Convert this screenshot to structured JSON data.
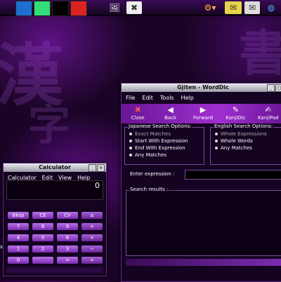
{
  "panel": {
    "swatches": [
      "#1e6fd0",
      "#33dd77",
      "#000000",
      "#dd2222"
    ],
    "icons": [
      "image-viewer-icon",
      "settings-icon",
      "network-icon",
      "archive-icon",
      "mail-icon",
      "globe-icon"
    ]
  },
  "wordd": {
    "title": "Gjiten - WordDic",
    "menu": [
      "File",
      "Edit",
      "Tools",
      "Help"
    ],
    "toolbar": [
      "Close",
      "Back",
      "Forward",
      "KanjiDic",
      "KanjiPad"
    ],
    "jp_group_title": "Japanese Search Options:",
    "jp_options": [
      "Exact Matches",
      "Start With Expression",
      "End With Expression",
      "Any Matches"
    ],
    "en_group_title": "English Search Options:",
    "en_options": [
      "Whole Expressions",
      "Whole Words",
      "Any Matches"
    ],
    "expression_label": "Enter expression :",
    "results_label": "Search results :"
  },
  "calculator": {
    "title": "Calculator",
    "menu": [
      "Calculator",
      "Edit",
      "View",
      "Help"
    ],
    "display": "0",
    "keys": [
      [
        "Bksp",
        "CE",
        "Clr",
        "±"
      ],
      [
        "7",
        "8",
        "9",
        "+"
      ],
      [
        "4",
        "5",
        "6",
        "×"
      ],
      [
        "1",
        "2",
        "3",
        "−"
      ],
      [
        "0",
        ".",
        "=",
        "+"
      ]
    ],
    "side_char": "s"
  }
}
